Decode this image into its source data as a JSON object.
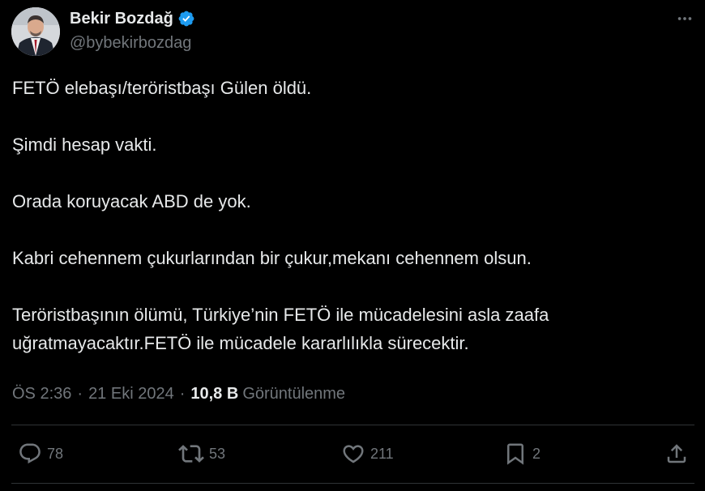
{
  "author": {
    "display_name": "Bekir Bozdağ",
    "handle": "@bybekirbozdag",
    "verified_icon": "verified-badge-icon",
    "accent_color": "#1d9bf0"
  },
  "tweet": {
    "paragraphs": [
      "FETÖ elebaşı/teröristbaşı Gülen öldü.",
      "Şimdi hesap vakti.",
      "Orada koruyacak ABD de yok.",
      "Kabri cehennem çukurlarından bir çukur,mekanı cehennem olsun.",
      "Teröristbaşının ölümü, Türkiye’nin FETÖ ile mücadelesini asla zaafa",
      "uğratmayacaktır.FETÖ ile mücadele kararlılıkla sürecektir."
    ]
  },
  "meta": {
    "time": "ÖS 2:36",
    "separator": "·",
    "date": "21 Eki 2024",
    "views_count": "10,8 B",
    "views_label": "Görüntülenme"
  },
  "actions": {
    "reply_count": "78",
    "retweet_count": "53",
    "like_count": "211",
    "bookmark_count": "2"
  },
  "colors": {
    "background": "#000000",
    "text_primary": "#e7e9ea",
    "text_secondary": "#71767b",
    "divider": "#2f3336"
  }
}
